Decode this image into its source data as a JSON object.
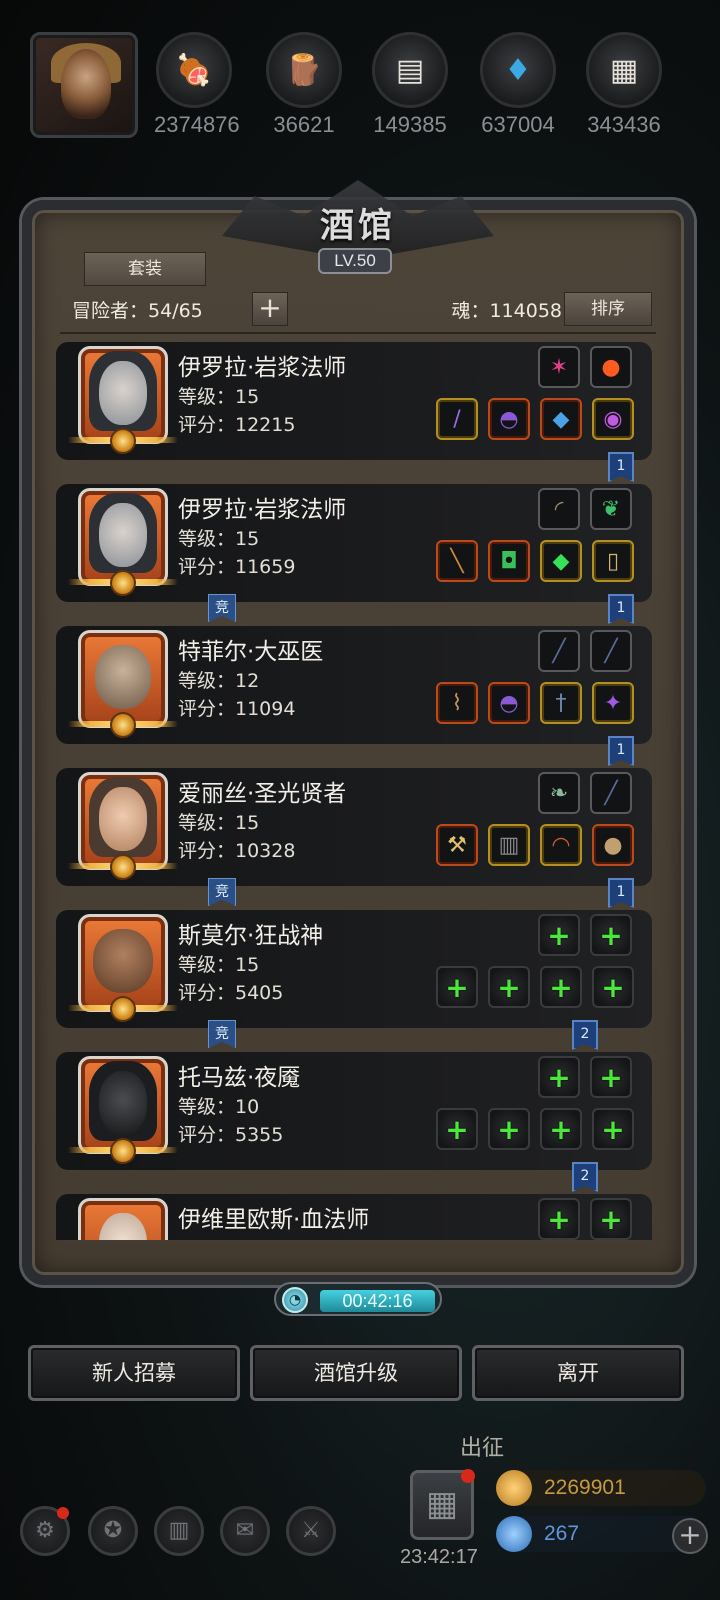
{
  "resources": [
    {
      "icon": "meat-icon",
      "value": "2374876"
    },
    {
      "icon": "wood-icon",
      "value": "36621"
    },
    {
      "icon": "iron-ore-icon",
      "value": "149385"
    },
    {
      "icon": "crystal-icon",
      "value": "637004"
    },
    {
      "icon": "stone-icon",
      "value": "343436"
    }
  ],
  "tavern": {
    "title": "酒馆",
    "level": "LV.50",
    "set_label": "套装",
    "adventurers_label": "冒险者：54/65",
    "soul_label": "魂：114058",
    "sort_label": "排序",
    "plus_symbol": "+"
  },
  "heroes": [
    {
      "name": "伊罗拉·岩浆法师",
      "level": "等级：15",
      "score": "评分：12215",
      "tag": "1",
      "arena": ""
    },
    {
      "name": "伊罗拉·岩浆法师",
      "level": "等级：15",
      "score": "评分：11659",
      "tag": "1",
      "arena": "竞"
    },
    {
      "name": "特菲尔·大巫医",
      "level": "等级：12",
      "score": "评分：11094",
      "tag": "1",
      "arena": ""
    },
    {
      "name": "爱丽丝·圣光贤者",
      "level": "等级：15",
      "score": "评分：10328",
      "tag": "1",
      "arena": "竞"
    },
    {
      "name": "斯莫尔·狂战神",
      "level": "等级：15",
      "score": "评分：5405",
      "tag": "2",
      "arena": "竞"
    },
    {
      "name": "托马兹·夜魇",
      "level": "等级：10",
      "score": "评分：5355",
      "tag": "2",
      "arena": ""
    },
    {
      "name": "伊维里欧斯·血法师",
      "level": "",
      "score": "",
      "tag": "",
      "arena": ""
    }
  ],
  "timer": "00:42:16",
  "buttons": {
    "recruit": "新人招募",
    "upgrade": "酒馆升级",
    "leave": "离开"
  },
  "hud": {
    "expedition": "出征",
    "clock": "23:42:17",
    "gold": "2269901",
    "gems": "267",
    "plus": "+"
  },
  "colors": {
    "accent_gold": "#f0b447",
    "timer_cyan": "#47d0de",
    "empty_slot_green": "#4be83a",
    "tag_blue": "#1d3f7a"
  }
}
